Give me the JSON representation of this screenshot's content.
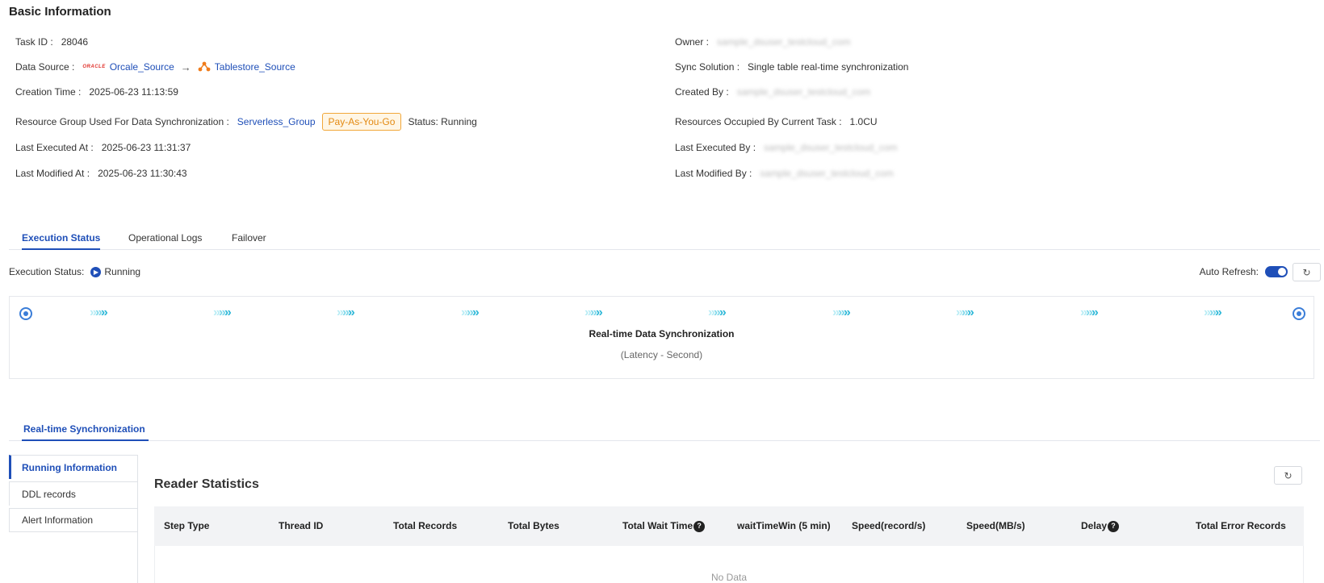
{
  "basic_info": {
    "title": "Basic Information",
    "task_id": {
      "label": "Task ID :",
      "value": "28046"
    },
    "data_source": {
      "label": "Data Source :",
      "oracle_logo_text": "ORACLE",
      "source": "Orcale_Source",
      "target": "Tablestore_Source"
    },
    "creation_time": {
      "label": "Creation Time :",
      "value": "2025-06-23 11:13:59"
    },
    "resource_group": {
      "label": "Resource Group Used For Data Synchronization :",
      "value": "Serverless_Group",
      "billing": "Pay-As-You-Go",
      "status": "Status: Running"
    },
    "last_executed_at": {
      "label": "Last Executed At :",
      "value": "2025-06-23 11:31:37"
    },
    "last_modified_at": {
      "label": "Last Modified At :",
      "value": "2025-06-23 11:30:43"
    },
    "owner": {
      "label": "Owner :",
      "value": "sample_dsuser_testcloud_com"
    },
    "sync_solution": {
      "label": "Sync Solution :",
      "value": "Single table real-time synchronization"
    },
    "created_by": {
      "label": "Created By :",
      "value": "sample_dsuser_testcloud_com"
    },
    "resources_occupied": {
      "label": "Resources Occupied By Current Task :",
      "value": "1.0CU"
    },
    "last_executed_by": {
      "label": "Last Executed By :",
      "value": "sample_dsuser_testcloud_com"
    },
    "last_modified_by": {
      "label": "Last Modified By :",
      "value": "sample_dsuser_testcloud_com"
    }
  },
  "main_tabs": [
    {
      "label": "Execution Status",
      "active": true
    },
    {
      "label": "Operational Logs",
      "active": false
    },
    {
      "label": "Failover",
      "active": false
    }
  ],
  "execution": {
    "label": "Execution Status:",
    "status": "Running",
    "auto_refresh_label": "Auto Refresh:",
    "auto_refresh_on": true
  },
  "pipeline": {
    "title": "Real-time Data Synchronization",
    "subtitle": "(Latency - Second)",
    "chevron_glyph": "»",
    "colors": {
      "light": "#b8ecf5",
      "mid": "#7fd8ea",
      "dark": "#2fb8d8",
      "endpoint": "#3a7dd8"
    }
  },
  "sync_tabs": [
    {
      "label": "Real-time Synchronization",
      "active": true
    }
  ],
  "side_menu": [
    {
      "label": "Running Information",
      "active": true
    },
    {
      "label": "DDL records",
      "active": false
    },
    {
      "label": "Alert Information",
      "active": false
    }
  ],
  "reader": {
    "title": "Reader Statistics",
    "columns": [
      {
        "label": "Step Type",
        "help": false
      },
      {
        "label": "Thread ID",
        "help": false
      },
      {
        "label": "Total Records",
        "help": false
      },
      {
        "label": "Total Bytes",
        "help": false
      },
      {
        "label": "Total Wait Time",
        "help": true
      },
      {
        "label": "waitTimeWin (5 min)",
        "help": false
      },
      {
        "label": "Speed(record/s)",
        "help": false
      },
      {
        "label": "Speed(MB/s)",
        "help": false
      },
      {
        "label": "Delay",
        "help": true
      },
      {
        "label": "Total Error Records",
        "help": false
      }
    ],
    "empty_text": "No Data"
  },
  "icons": {
    "refresh": "refresh-icon",
    "help": "question-circle-icon",
    "running": "running-status-icon",
    "arrow": "arrow-right-icon",
    "tablestore": "tablestore-icon"
  },
  "accent_color": "#1f4fb8"
}
